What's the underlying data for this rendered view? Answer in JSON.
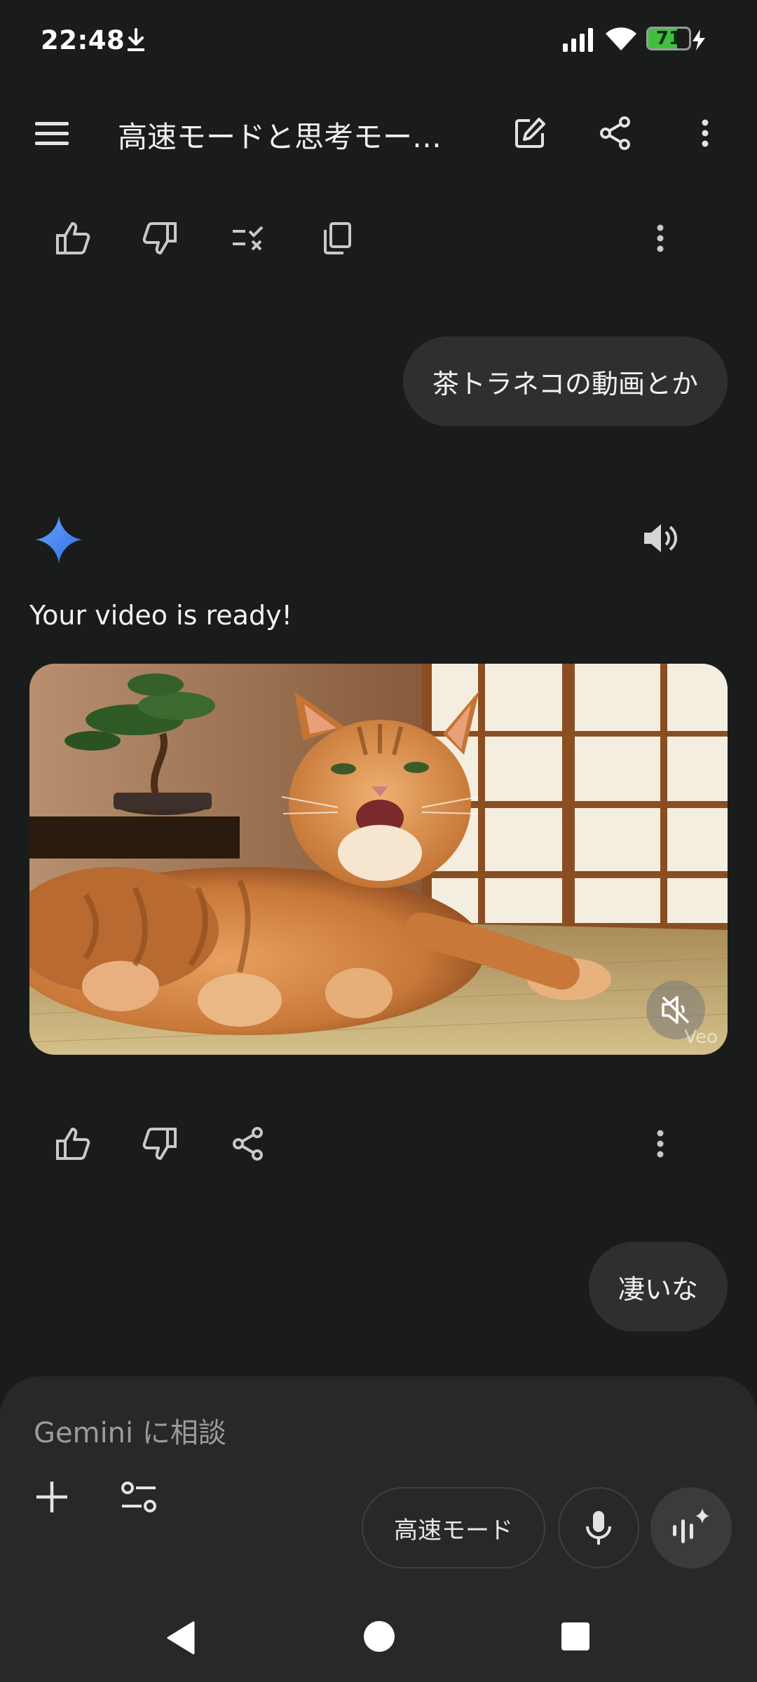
{
  "status_bar": {
    "time": "22:48",
    "battery_level": "71",
    "battery_fill_fraction": 0.71,
    "icons": [
      "download-icon",
      "signal-icon",
      "wifi-icon",
      "battery-icon",
      "charging-bolt-icon"
    ]
  },
  "top_bar": {
    "title": "高速モードと思考モード…",
    "icons": [
      "menu-icon",
      "edit-icon",
      "share-icon",
      "more-vert-icon"
    ]
  },
  "conversation": {
    "action_rows": [
      {
        "icons": [
          "thumb-up-icon",
          "thumb-down-icon",
          "checklist-icon",
          "copy-icon",
          "more-vert-icon"
        ]
      },
      {
        "icons": [
          "thumb-up-icon",
          "thumb-down-icon",
          "share-icon",
          "more-vert-icon"
        ]
      }
    ],
    "user_messages": [
      "茶トラネコの動画とか",
      "凄いな"
    ],
    "response": {
      "icon": "gemini-sparkle-icon",
      "speaker_icon": "volume-up-icon",
      "text": "Your video is ready!",
      "video": {
        "watermark": "Veo",
        "mute_icon": "volume-off-icon"
      }
    }
  },
  "input_panel": {
    "placeholder": "Gemini に相談",
    "mode_label": "高速モード",
    "icons": [
      "plus-icon",
      "tools-icon",
      "mic-icon",
      "live-icon"
    ]
  },
  "nav_bar": {
    "icons": [
      "back-icon",
      "home-icon",
      "recents-icon"
    ]
  },
  "colors": {
    "background": "#191c1b",
    "bubble": "#2e302f",
    "panel": "#272928",
    "accent_blue": "#4a8bf5",
    "battery_green": "#3ec23e"
  }
}
